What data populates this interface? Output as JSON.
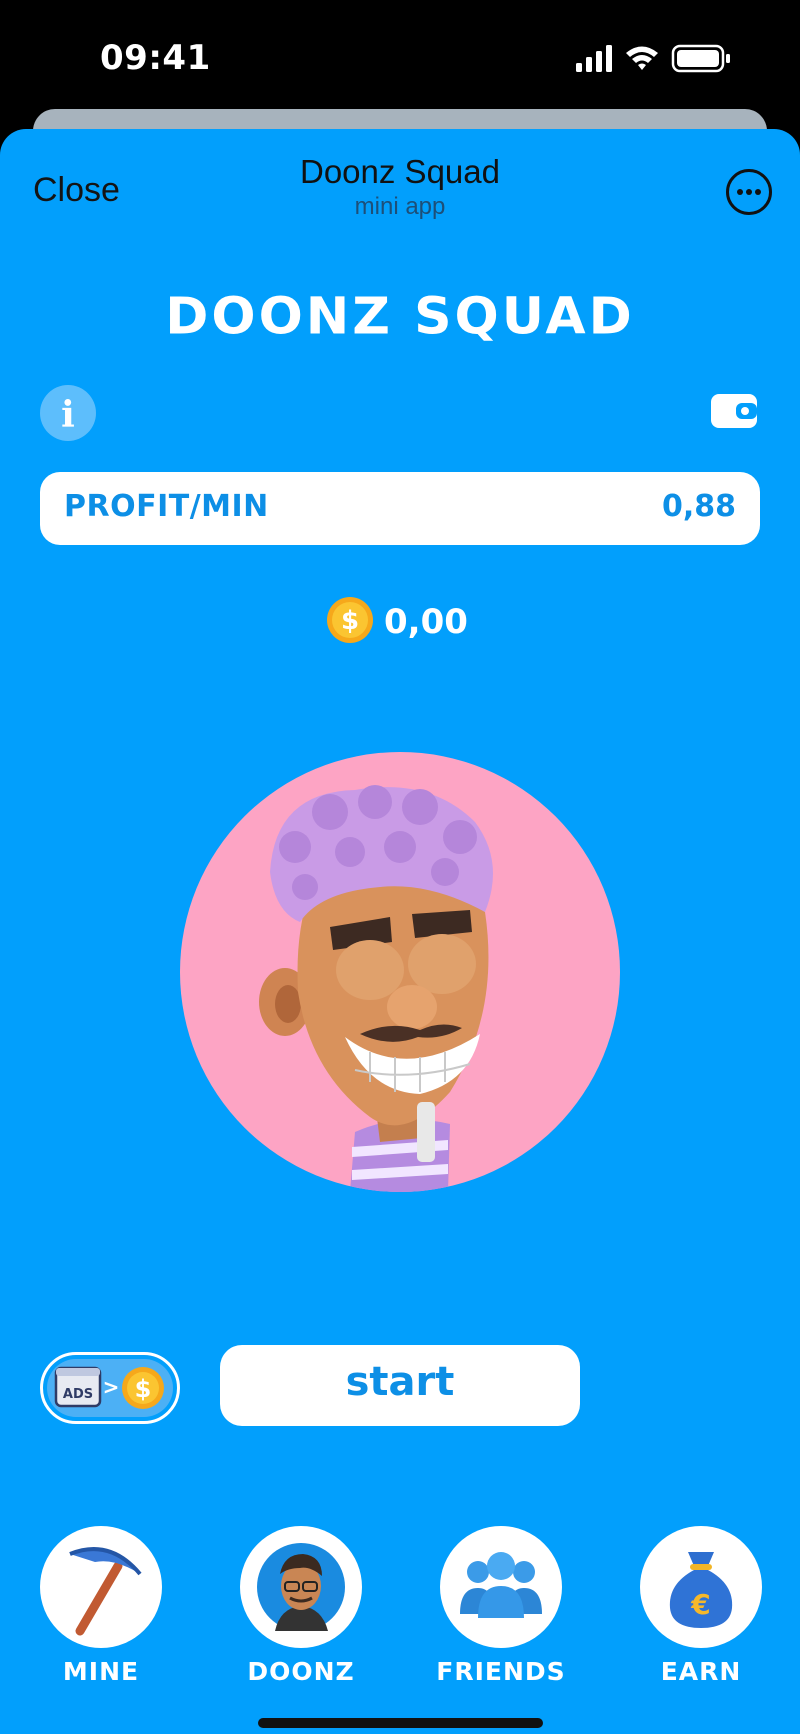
{
  "status_bar": {
    "time": "09:41"
  },
  "header": {
    "close_label": "Close",
    "title": "Doonz Squad",
    "subtitle": "mini app"
  },
  "brand": {
    "title": "DOONZ SQUAD"
  },
  "profit": {
    "label": "PROFIT/MIN",
    "value": "0,88"
  },
  "balance": {
    "value": "0,00"
  },
  "ads_badge": {
    "label": "ADS"
  },
  "start_button": {
    "label": "start"
  },
  "nav": {
    "items": [
      {
        "label": "MINE",
        "icon": "pickaxe-icon"
      },
      {
        "label": "DOONZ",
        "icon": "character-avatar-icon"
      },
      {
        "label": "FRIENDS",
        "icon": "people-icon"
      },
      {
        "label": "EARN",
        "icon": "money-bag-icon"
      }
    ]
  },
  "colors": {
    "background": "#029ffc",
    "avatar_bg": "#fda4c4",
    "accent_text": "#0d8fe6",
    "coin": "#f5b51c"
  }
}
